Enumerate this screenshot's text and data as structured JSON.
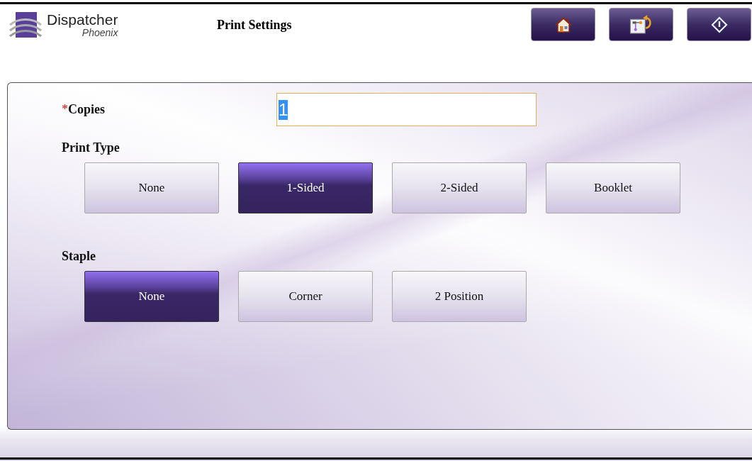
{
  "header": {
    "logo": {
      "name": "Dispatcher",
      "subtitle": "Phoenix"
    },
    "title": "Print Settings",
    "buttons": [
      {
        "kind": "home"
      },
      {
        "kind": "workflow-back"
      },
      {
        "kind": "start"
      }
    ]
  },
  "copies": {
    "required_mark": "*",
    "label": "Copies",
    "value": "1",
    "value_selected": true
  },
  "groups": [
    {
      "label": "Print Type",
      "options": [
        {
          "label": "None",
          "selected": false
        },
        {
          "label": "1-Sided",
          "selected": true
        },
        {
          "label": "2-Sided",
          "selected": false
        },
        {
          "label": "Booklet",
          "selected": false
        }
      ]
    },
    {
      "label": "Staple",
      "options": [
        {
          "label": "None",
          "selected": true
        },
        {
          "label": "Corner",
          "selected": false
        },
        {
          "label": "2 Position",
          "selected": false
        }
      ]
    }
  ]
}
